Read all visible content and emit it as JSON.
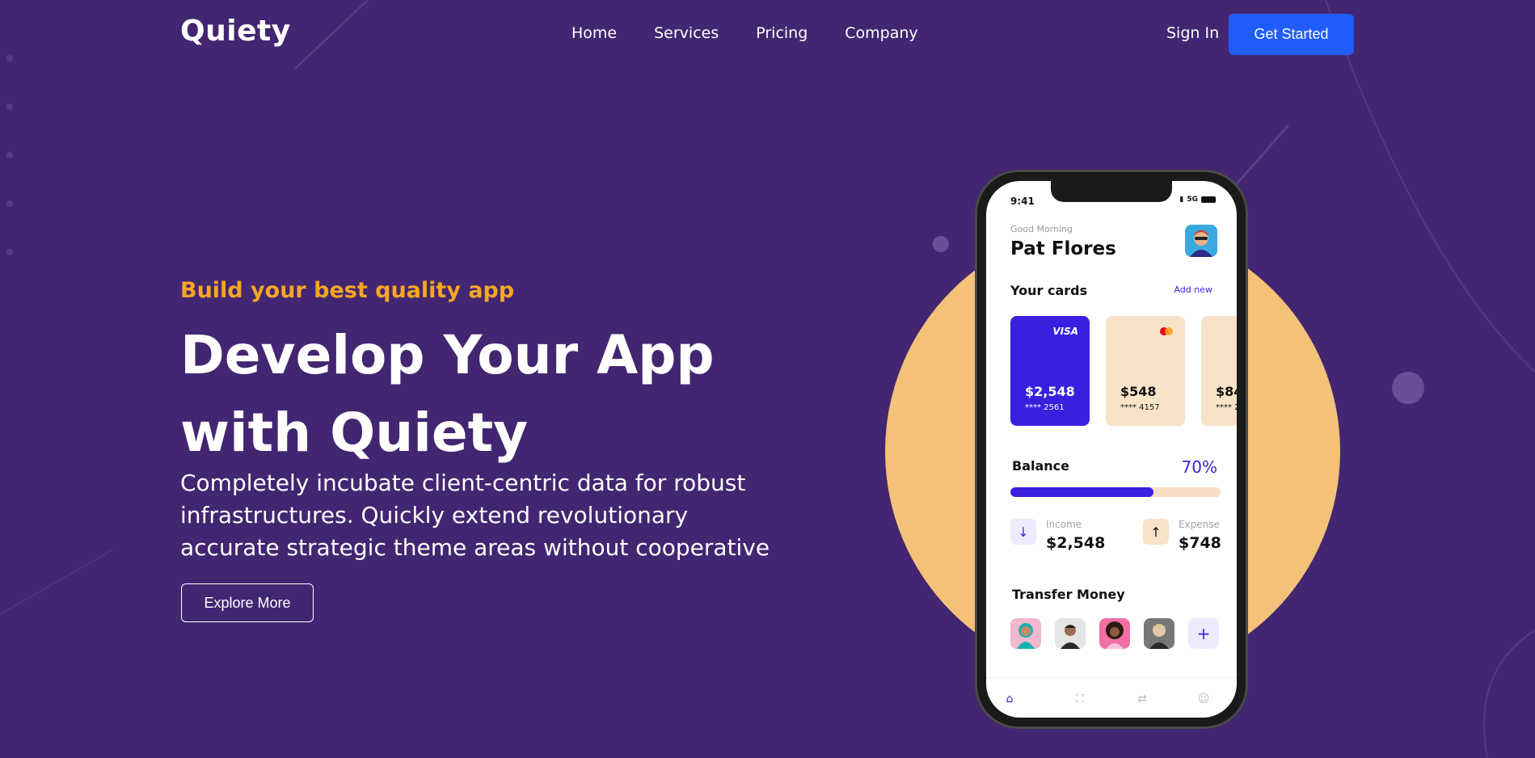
{
  "header": {
    "logo": "Quiety",
    "nav": [
      "Home",
      "Services",
      "Pricing",
      "Company"
    ],
    "sign_in": "Sign In",
    "get_started": "Get Started"
  },
  "hero": {
    "eyebrow": "Build your best quality app",
    "headline_line1": "Develop Your App",
    "headline_line2": "with Quiety",
    "lead": "Completely incubate client-centric data for robust infrastructures. Quickly extend revolutionary accurate strategic theme areas without cooperative",
    "explore": "Explore More"
  },
  "phone": {
    "time": "9:41",
    "network": "5G",
    "greeting": "Good Morning",
    "user_name": "Pat Flores",
    "cards_title": "Your cards",
    "add_new": "Add new",
    "cards": [
      {
        "brand": "VISA",
        "amount": "$2,548",
        "number": "**** 2561"
      },
      {
        "brand": "mastercard",
        "amount": "$548",
        "number": "**** 4157"
      },
      {
        "brand": "",
        "amount": "$84",
        "number": "**** 2"
      }
    ],
    "balance_title": "Balance",
    "balance_pct_label": "70%",
    "balance_pct": 0.68,
    "income_label": "Income",
    "income_value": "$2,548",
    "expense_label": "Expense",
    "expense_value": "$748",
    "transfer_title": "Transfer Money",
    "add_symbol": "+"
  },
  "colors": {
    "background": "#432671",
    "accent": "#f6a623",
    "cta": "#1f5cfb",
    "circle": "#f4c178",
    "app_primary": "#3b1fe0"
  }
}
